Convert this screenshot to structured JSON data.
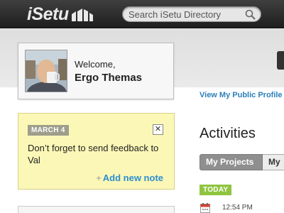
{
  "header": {
    "logo_text": "iSetu",
    "search": {
      "placeholder": "Search iSetu Directory"
    }
  },
  "profile": {
    "welcome_label": "Welcome,",
    "name": "Ergo Themas",
    "public_profile_link": "View My Public Profile"
  },
  "note": {
    "date": "MARCH 4",
    "close_label": "✕",
    "text": "Don’t forget to send feedback to Val",
    "add_plus": "+",
    "add_label": "Add new note"
  },
  "activities": {
    "title": "Activities",
    "tabs": [
      {
        "label": "My Projects",
        "active": true
      },
      {
        "label": "My",
        "active": false
      }
    ],
    "today_badge": "TODAY",
    "items": [
      {
        "icon": "calendar-icon",
        "time": "12:54 PM"
      }
    ]
  },
  "colors": {
    "topbar": "#2a2a2a",
    "link_blue": "#2b7fb8",
    "note_yellow": "#fbf7b6",
    "today_green": "#8fc540",
    "active_tab": "#8f8f8f"
  }
}
